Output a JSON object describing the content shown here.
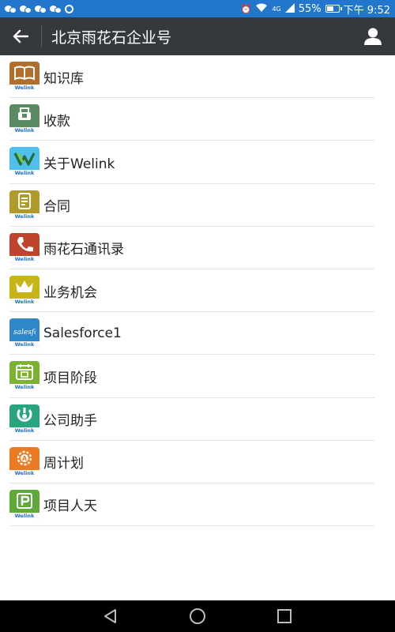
{
  "status_bar": {
    "network": "4G",
    "battery": "55%",
    "time": "下午 9:52"
  },
  "header": {
    "title": "北京雨花石企业号",
    "back_icon": "back-arrow-icon",
    "user_icon": "user-profile-icon"
  },
  "welink_tag": "Welink",
  "items": [
    {
      "label": "知识库",
      "icon": "book-icon",
      "color": "#b0702d"
    },
    {
      "label": "收款",
      "icon": "payment-icon",
      "color": "#5a8b62"
    },
    {
      "label": "关于Welink",
      "icon": "welink-logo-icon",
      "color": "#4fc0ec"
    },
    {
      "label": "合同",
      "icon": "contract-icon",
      "color": "#b09a2a"
    },
    {
      "label": "雨花石通讯录",
      "icon": "phone-icon",
      "color": "#c0432c"
    },
    {
      "label": "业务机会",
      "icon": "crown-icon",
      "color": "#c7b416"
    },
    {
      "label": "Salesforce1",
      "icon": "salesforce-icon",
      "color": "#2f86c8"
    },
    {
      "label": "项目阶段",
      "icon": "calendar-icon",
      "color": "#7bb232"
    },
    {
      "label": "公司助手",
      "icon": "assistant-icon",
      "color": "#2aa37f"
    },
    {
      "label": "周计划",
      "icon": "gear-plan-icon",
      "color": "#ec7a22"
    },
    {
      "label": "项目人天",
      "icon": "parking-p-icon",
      "color": "#5fa83a"
    }
  ],
  "salesforce_logo_text": "salesforce",
  "nav": {
    "back": "nav-back-icon",
    "home": "nav-home-icon",
    "recents": "nav-recents-icon"
  }
}
